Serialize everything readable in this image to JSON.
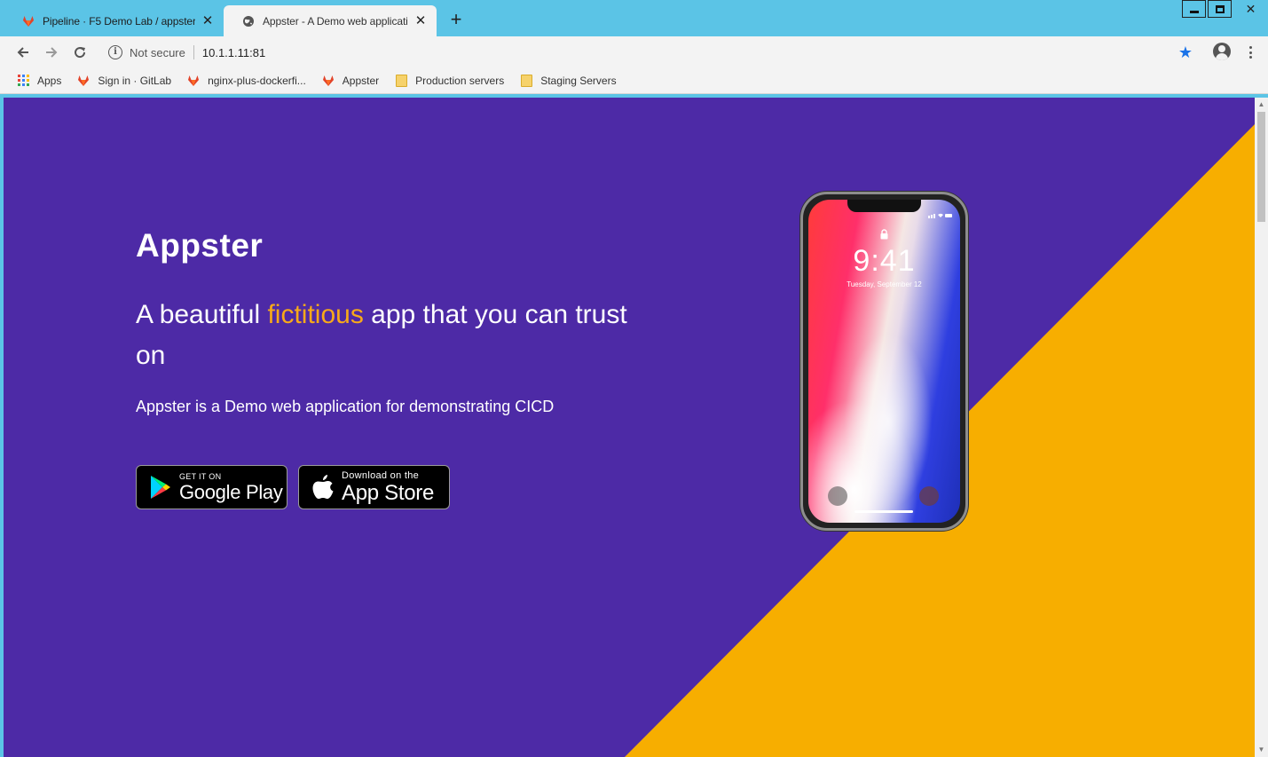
{
  "browser": {
    "tabs": [
      {
        "title": "Pipeline · F5 Demo Lab / appster",
        "active": false,
        "icon": "gitlab-fox-icon"
      },
      {
        "title": "Appster - A Demo web applicatio",
        "active": true,
        "icon": "globe-icon"
      }
    ],
    "address": {
      "security_label": "Not secure",
      "url": "10.1.1.11:81"
    },
    "bookmarks": [
      {
        "label": "Apps",
        "icon": "apps-grid-icon"
      },
      {
        "label": "Sign in · GitLab",
        "icon": "gitlab-fox-icon"
      },
      {
        "label": "nginx-plus-dockerfi...",
        "icon": "gitlab-fox-icon"
      },
      {
        "label": "Appster",
        "icon": "gitlab-fox-icon"
      },
      {
        "label": "Production servers",
        "icon": "folder-icon"
      },
      {
        "label": "Staging Servers",
        "icon": "folder-icon"
      }
    ]
  },
  "page": {
    "brand": "Appster",
    "headline": {
      "before": "A beautiful ",
      "accent": "fictitious",
      "after": " app that you can trust on"
    },
    "tagline": "Appster is a Demo web application for demonstrating CICD",
    "store_buttons": {
      "google_play": {
        "small": "GET IT ON",
        "big": "Google Play"
      },
      "app_store": {
        "small": "Download on the",
        "big": "App Store"
      }
    },
    "phone": {
      "time": "9:41",
      "date": "Tuesday, September 12"
    },
    "colors": {
      "background": "#4d2aa6",
      "accent": "#f7a91a",
      "diagonal": "#f7ae00"
    }
  }
}
